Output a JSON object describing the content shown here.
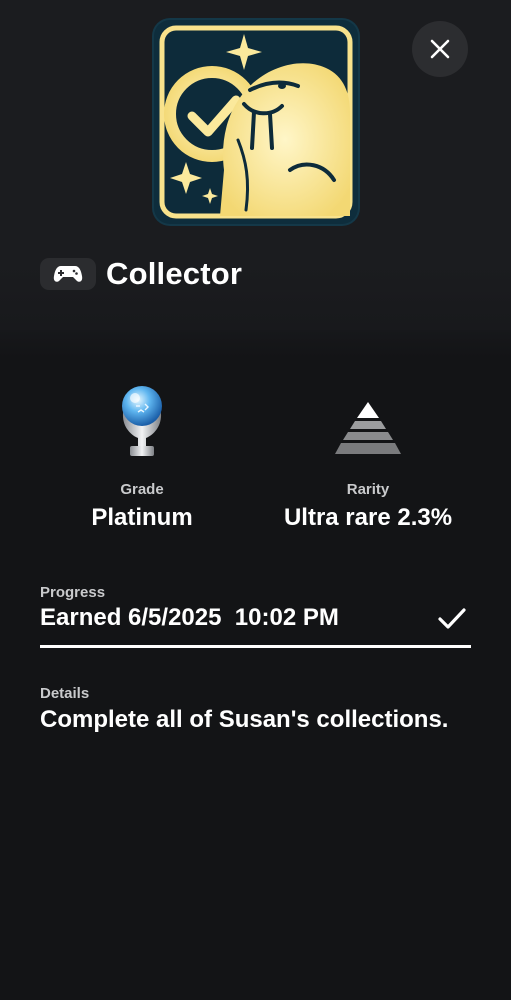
{
  "trophy": {
    "title": "Collector",
    "art_icon": "walrus-collector-art-icon",
    "game_icon": "gamepad-icon"
  },
  "close_button": {
    "icon": "close-icon"
  },
  "grade": {
    "label": "Grade",
    "value": "Platinum",
    "icon": "platinum-trophy-icon"
  },
  "rarity": {
    "label": "Rarity",
    "value": "Ultra rare 2.3%",
    "icon": "rarity-pyramid-icon"
  },
  "progress": {
    "label": "Progress",
    "value": "Earned 6/5/2025  10:02 PM",
    "icon": "checkmark-icon",
    "completion": 1.0
  },
  "details": {
    "label": "Details",
    "value": "Complete all of Susan's collections."
  },
  "colors": {
    "background": "#131416",
    "header": "#1b1c1f",
    "art_frame": "#0e2d3c",
    "art_gold": "#fbe99c"
  }
}
